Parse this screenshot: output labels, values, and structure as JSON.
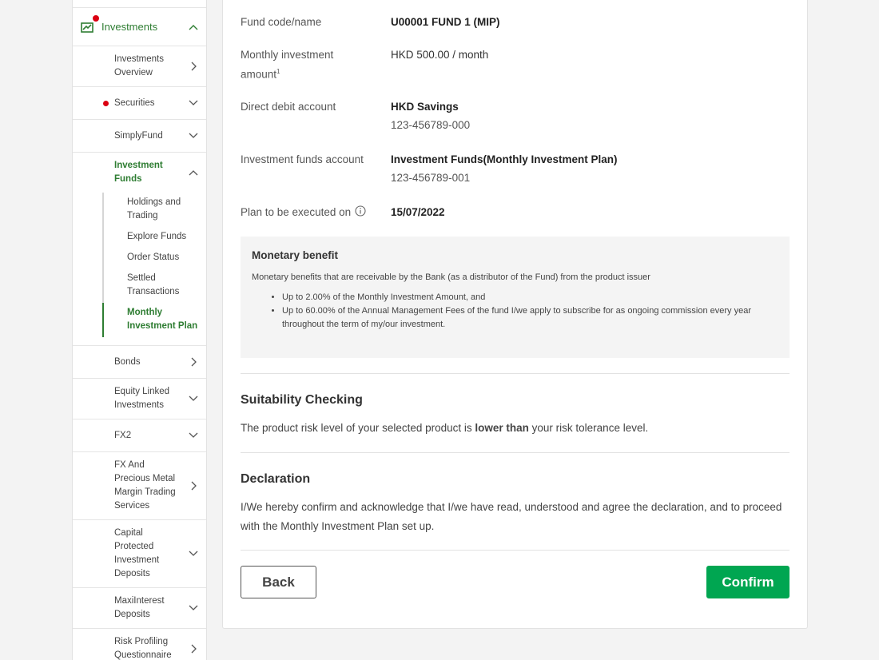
{
  "sidebar": {
    "header": {
      "label": "Investments",
      "icon": "chart-icon"
    },
    "items": [
      {
        "label": "Investments Overview",
        "chevron": "right"
      },
      {
        "label": "Securities",
        "chevron": "down",
        "alert": true
      },
      {
        "label": "SimplyFund",
        "chevron": "down"
      },
      {
        "label": "Investment Funds",
        "chevron": "up",
        "active": true
      },
      {
        "label": "Bonds",
        "chevron": "right"
      },
      {
        "label": "Equity Linked Investments",
        "chevron": "down"
      },
      {
        "label": "FX2",
        "chevron": "down"
      },
      {
        "label": "FX And Precious Metal Margin Trading Services",
        "chevron": "right"
      },
      {
        "label": "Capital Protected Investment Deposits",
        "chevron": "down"
      },
      {
        "label": "MaxiInterest Deposits",
        "chevron": "down"
      },
      {
        "label": "Risk Profiling Questionnaire",
        "chevron": "right"
      }
    ],
    "sub_items": [
      {
        "label": "Holdings and Trading"
      },
      {
        "label": "Explore Funds"
      },
      {
        "label": "Order Status"
      },
      {
        "label": "Settled Transactions"
      },
      {
        "label": "Monthly Investment Plan",
        "active": true
      }
    ]
  },
  "details": {
    "fund_label": "Fund code/name",
    "fund_value": "U00001 FUND 1 (MIP)",
    "amount_label": "Monthly investment amount",
    "amount_sup": "1",
    "amount_value": "HKD 500.00 / month",
    "debit_label": "Direct debit account",
    "debit_name": "HKD Savings",
    "debit_number": "123-456789-000",
    "funds_label": "Investment funds account",
    "funds_name": "Investment Funds(Monthly Investment Plan)",
    "funds_number": "123-456789-001",
    "date_label": "Plan to be executed on",
    "date_value": "15/07/2022"
  },
  "benefit": {
    "title": "Monetary benefit",
    "intro": "Monetary benefits that are receivable by the Bank (as a distributor of the Fund) from the product issuer",
    "bullet1": "Up to 2.00% of the Monthly Investment Amount, and",
    "bullet2": "Up to 60.00% of the Annual Management Fees of the fund I/we apply to subscribe for as ongoing commission every year throughout the term of my/our investment."
  },
  "suitability": {
    "title": "Suitability Checking",
    "text_pre": "The product risk level of your selected product is ",
    "text_strong": "lower than",
    "text_post": " your risk tolerance level."
  },
  "declaration": {
    "title": "Declaration",
    "text": "I/We hereby confirm and acknowledge that I/we have read, understood and agree the declaration, and to proceed with the Monthly Investment Plan set up."
  },
  "actions": {
    "back": "Back",
    "confirm": "Confirm"
  },
  "colors": {
    "brand_green": "#00a651",
    "nav_green": "#2e7d32",
    "alert_red": "#db0011"
  }
}
